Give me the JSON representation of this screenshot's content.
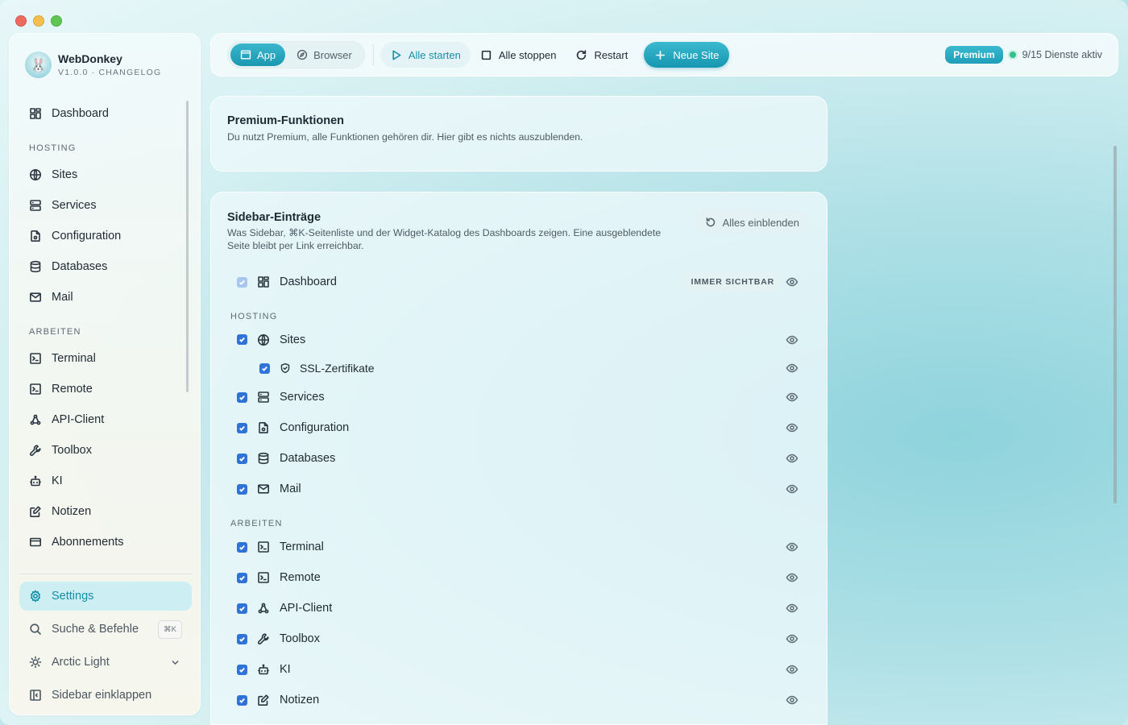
{
  "brand": {
    "name": "WebDonkey",
    "subtitle": "V1.0.0 · CHANGELOG"
  },
  "sidebar": {
    "dashboard": "Dashboard",
    "section_hosting": "HOSTING",
    "hosting": [
      "Sites",
      "Services",
      "Configuration",
      "Databases",
      "Mail"
    ],
    "section_arbeiten": "ARBEITEN",
    "arbeiten": [
      "Terminal",
      "Remote",
      "API-Client",
      "Toolbox",
      "KI",
      "Notizen",
      "Abonnements"
    ],
    "settings": "Settings",
    "search": "Suche & Befehle",
    "search_kbd": "⌘K",
    "theme": "Arctic Light",
    "collapse": "Sidebar einklappen"
  },
  "toolbar": {
    "app": "App",
    "browser": "Browser",
    "start_all": "Alle starten",
    "stop_all": "Alle stoppen",
    "restart": "Restart",
    "new_site": "Neue Site",
    "premium": "Premium",
    "status": "9/15 Dienste aktiv"
  },
  "premium_card": {
    "title": "Premium-Funktionen",
    "desc": "Du nutzt Premium, alle Funktionen gehören dir. Hier gibt es nichts auszublenden."
  },
  "sidebar_card": {
    "title": "Sidebar-Einträge",
    "desc_line1": "Was Sidebar, ⌘K-Seitenliste und der Widget-Katalog des Dashboards zeigen. Eine ausgeblendete",
    "desc_line2": "Seite bleibt per Link erreichbar.",
    "reset": "Alles einblenden",
    "dashboard": "Dashboard",
    "always_visible": "IMMER SICHTBAR",
    "section_hosting": "HOSTING",
    "sites": "Sites",
    "ssl": "SSL-Zertifikate",
    "services": "Services",
    "configuration": "Configuration",
    "databases": "Databases",
    "mail": "Mail",
    "section_arbeiten": "ARBEITEN",
    "terminal": "Terminal",
    "remote": "Remote",
    "api_client": "API-Client",
    "toolbox": "Toolbox",
    "ki": "KI",
    "notizen": "Notizen"
  },
  "colors": {
    "accent": "#1998b1",
    "checkbox": "#2f73d8",
    "status_ok": "#36c28a"
  }
}
